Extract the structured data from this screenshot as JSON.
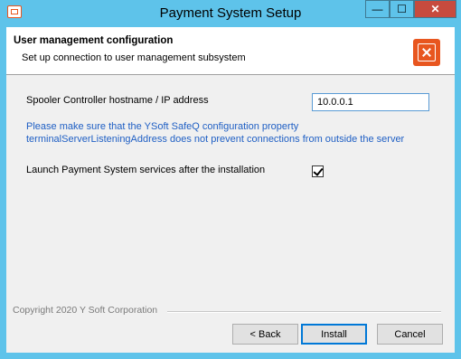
{
  "window": {
    "title": "Payment System Setup"
  },
  "title_controls": {
    "minimize": "—",
    "maximize": "☐",
    "close": "✕"
  },
  "header": {
    "title": "User management configuration",
    "subtitle": "Set up connection to user management subsystem",
    "icon": "safe-icon"
  },
  "form": {
    "host_label": "Spooler Controller hostname / IP address",
    "host_value": "10.0.0.1",
    "note_line1": "Please make sure that the YSoft SafeQ configuration property",
    "note_line2": "terminalServerListeningAddress does not prevent connections from outside the server",
    "launch_label": "Launch Payment System services after the installation",
    "launch_checked": true
  },
  "footer": {
    "copyright": "Copyright 2020 Y Soft Corporation",
    "back_label": "< Back",
    "install_label": "Install",
    "cancel_label": "Cancel"
  },
  "colors": {
    "titlebar": "#5ec3ea",
    "accent": "#e8561f",
    "note": "#1f5fc4"
  }
}
